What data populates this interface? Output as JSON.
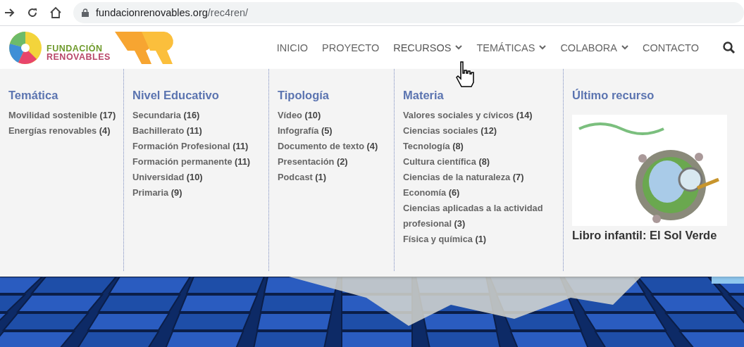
{
  "browser": {
    "url_host": "fundacionrenovables.org",
    "url_path": "/rec4ren/"
  },
  "logo": {
    "line_1": "FUNDACIÓN",
    "line_2": "RENOVABLES"
  },
  "nav": [
    {
      "label": "INICIO",
      "has_menu": false,
      "selected": false
    },
    {
      "label": "PROYECTO",
      "has_menu": false,
      "selected": false
    },
    {
      "label": "RECURSOS",
      "has_menu": true,
      "selected": true
    },
    {
      "label": "TEMÁTICAS",
      "has_menu": true,
      "selected": false
    },
    {
      "label": "COLABORA",
      "has_menu": true,
      "selected": false
    },
    {
      "label": "CONTACTO",
      "has_menu": false,
      "selected": false
    }
  ],
  "menu": {
    "columns": [
      {
        "heading": "Temática",
        "items": [
          {
            "name": "Movilidad sostenible",
            "count": "(17)"
          },
          {
            "name": "Energías renovables",
            "count": "(4)"
          }
        ]
      },
      {
        "heading": "Nivel Educativo",
        "items": [
          {
            "name": "Secundaria",
            "count": "(16)"
          },
          {
            "name": "Bachillerato",
            "count": "(11)"
          },
          {
            "name": "Formación Profesional",
            "count": "(11)"
          },
          {
            "name": "Formación permanente",
            "count": "(11)"
          },
          {
            "name": "Universidad",
            "count": "(10)"
          },
          {
            "name": "Primaria",
            "count": "(9)"
          }
        ]
      },
      {
        "heading": "Tipología",
        "items": [
          {
            "name": "Vídeo",
            "count": "(10)"
          },
          {
            "name": "Infografía",
            "count": "(5)"
          },
          {
            "name": "Documento de texto",
            "count": "(4)"
          },
          {
            "name": "Presentación",
            "count": "(2)"
          },
          {
            "name": "Podcast",
            "count": "(1)"
          }
        ]
      },
      {
        "heading": "Materia",
        "items": [
          {
            "name": "Valores sociales y cívicos",
            "count": "(14)"
          },
          {
            "name": "Ciencias sociales",
            "count": "(12)"
          },
          {
            "name": "Tecnología",
            "count": "(8)"
          },
          {
            "name": "Cultura científica",
            "count": "(8)"
          },
          {
            "name": "Ciencias de la naturaleza",
            "count": "(7)"
          },
          {
            "name": "Economía",
            "count": "(6)"
          },
          {
            "name": "Ciencias aplicadas a la actividad profesional",
            "count": "(3)"
          },
          {
            "name": "Física y química",
            "count": "(1)"
          }
        ]
      }
    ],
    "latest": {
      "heading": "Último recurso",
      "title": "Libro infantil: El Sol Verde"
    }
  }
}
